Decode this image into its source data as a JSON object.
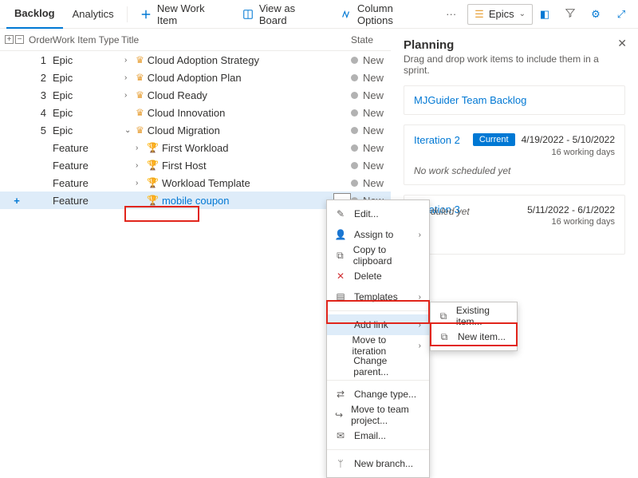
{
  "tabs": {
    "backlog": "Backlog",
    "analytics": "Analytics"
  },
  "toolbar": {
    "new_work_item": "New Work Item",
    "view_as_board": "View as Board",
    "column_options": "Column Options",
    "epics_label": "Epics"
  },
  "grid": {
    "headers": {
      "order": "Order",
      "type": "Work Item Type",
      "title": "Title",
      "state": "State"
    },
    "rows": [
      {
        "order": "1",
        "type": "Epic",
        "title": "Cloud Adoption Strategy",
        "state": "New",
        "indent": 1,
        "icon": "crown",
        "chev": ">"
      },
      {
        "order": "2",
        "type": "Epic",
        "title": "Cloud Adoption Plan",
        "state": "New",
        "indent": 1,
        "icon": "crown",
        "chev": ">"
      },
      {
        "order": "3",
        "type": "Epic",
        "title": "Cloud Ready",
        "state": "New",
        "indent": 1,
        "icon": "crown",
        "chev": ">"
      },
      {
        "order": "4",
        "type": "Epic",
        "title": "Cloud Innovation",
        "state": "New",
        "indent": 1,
        "icon": "crown",
        "chev": ""
      },
      {
        "order": "5",
        "type": "Epic",
        "title": "Cloud Migration",
        "state": "New",
        "indent": 1,
        "icon": "crown",
        "chev": "v"
      },
      {
        "order": "",
        "type": "Feature",
        "title": "First Workload",
        "state": "New",
        "indent": 2,
        "icon": "trophy",
        "chev": ">"
      },
      {
        "order": "",
        "type": "Feature",
        "title": "First Host",
        "state": "New",
        "indent": 2,
        "icon": "trophy",
        "chev": ">"
      },
      {
        "order": "",
        "type": "Feature",
        "title": "Workload Template",
        "state": "New",
        "indent": 2,
        "icon": "trophy",
        "chev": ">"
      },
      {
        "order": "",
        "type": "Feature",
        "title": "mobile coupon",
        "state": "New",
        "indent": 2,
        "icon": "trophy",
        "chev": "",
        "selected": true
      }
    ]
  },
  "context_menu": {
    "edit": "Edit...",
    "assign_to": "Assign to",
    "copy": "Copy to clipboard",
    "delete": "Delete",
    "templates": "Templates",
    "add_link": "Add link",
    "move_iter": "Move to iteration",
    "change_parent": "Change parent...",
    "change_type": "Change type...",
    "move_project": "Move to team project...",
    "email": "Email...",
    "new_branch": "New branch..."
  },
  "submenu": {
    "existing": "Existing item...",
    "new_item": "New item..."
  },
  "planning": {
    "title": "Planning",
    "subtitle": "Drag and drop work items to include them in a sprint.",
    "backlog_name": "MJGuider Team Backlog",
    "iter2": {
      "name": "Iteration 2",
      "current": "Current",
      "dates": "4/19/2022 - 5/10/2022",
      "days": "16 working days",
      "nowork": "No work scheduled yet"
    },
    "iter3": {
      "name": "Iteration 3",
      "dates": "5/11/2022 - 6/1/2022",
      "days": "16 working days",
      "nowork_partial": "duled yet"
    }
  }
}
